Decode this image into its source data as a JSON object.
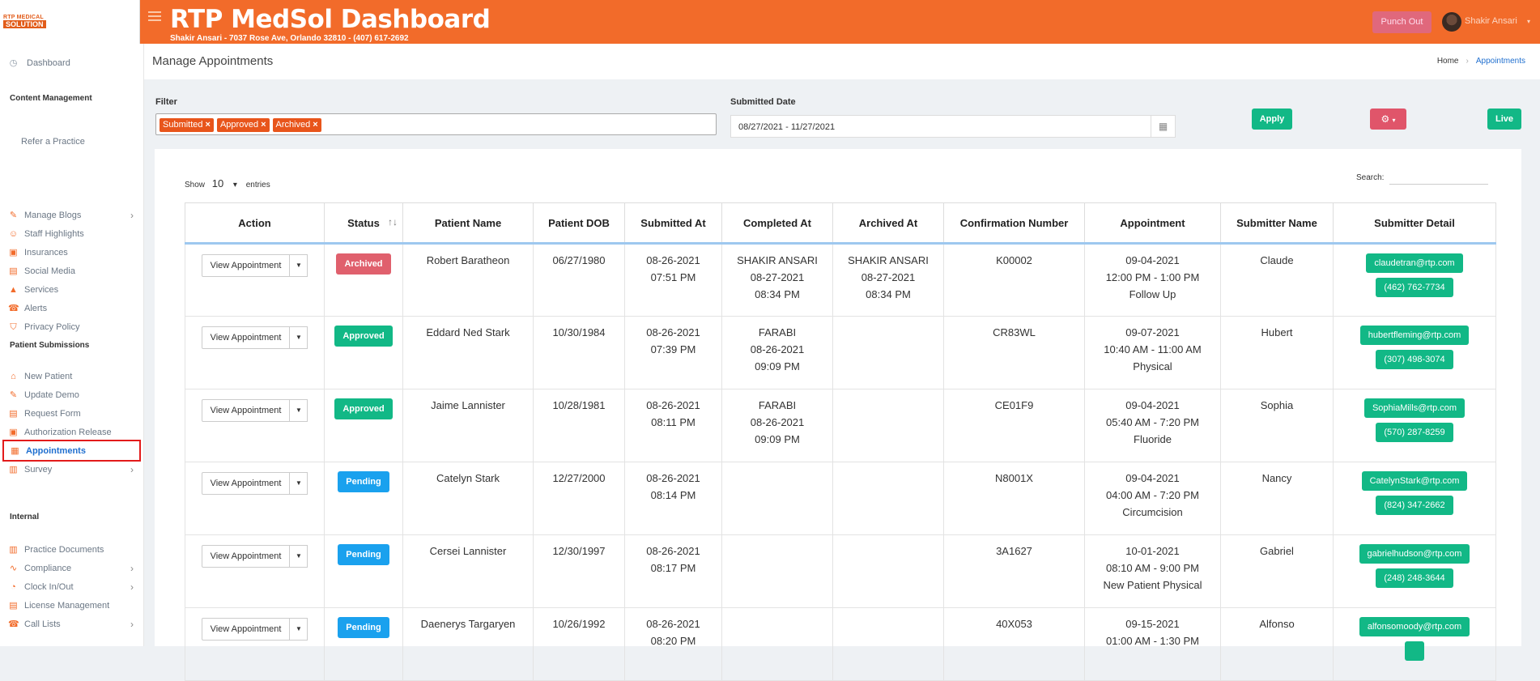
{
  "brand": {
    "logo_line1": "RTP MEDICAL",
    "logo_line2": "SOLUTION"
  },
  "header": {
    "title": "RTP MedSol Dashboard",
    "subtitle": "Shakir Ansari - 7037 Rose Ave, Orlando 32810 - (407) 617-2692",
    "punch_label": "Punch Out",
    "user_name": "Shakir Ansari"
  },
  "sidebar": {
    "dashboard": "Dashboard",
    "content_head": "Content Management",
    "refer": "Refer a Practice",
    "items1": [
      {
        "label": "Manage Blogs",
        "icon": "blog-icon",
        "chevron": true
      },
      {
        "label": "Staff Highlights",
        "icon": "staff-icon"
      },
      {
        "label": "Insurances",
        "icon": "insurance-icon"
      },
      {
        "label": "Social Media",
        "icon": "social-icon"
      },
      {
        "label": "Services",
        "icon": "services-icon"
      },
      {
        "label": "Alerts",
        "icon": "alert-icon"
      },
      {
        "label": "Privacy Policy",
        "icon": "shield-icon"
      }
    ],
    "patient_head": "Patient Submissions",
    "items2": [
      {
        "label": "New Patient",
        "icon": "home-icon"
      },
      {
        "label": "Update Demo",
        "icon": "update-icon"
      },
      {
        "label": "Request Form",
        "icon": "form-icon"
      },
      {
        "label": "Authorization Release",
        "icon": "auth-icon"
      },
      {
        "label": "Appointments",
        "icon": "calendar-icon",
        "active": true
      },
      {
        "label": "Survey",
        "icon": "survey-icon",
        "chevron": true
      }
    ],
    "internal_head": "Internal",
    "items3": [
      {
        "label": "Practice Documents",
        "icon": "documents-icon"
      },
      {
        "label": "Compliance",
        "icon": "compliance-icon",
        "chevron": true
      },
      {
        "label": "Clock In/Out",
        "icon": "clock-icon",
        "chevron": true
      },
      {
        "label": "License Management",
        "icon": "license-icon"
      },
      {
        "label": "Call Lists",
        "icon": "phone-icon",
        "chevron": true
      }
    ]
  },
  "page": {
    "title": "Manage Appointments",
    "breadcrumb_home": "Home",
    "breadcrumb_current": "Appointments"
  },
  "filters": {
    "filter_label": "Filter",
    "tags": [
      "Submitted",
      "Approved",
      "Archived"
    ],
    "date_label": "Submitted Date",
    "date_value": "08/27/2021 - 11/27/2021",
    "apply_label": "Apply",
    "live_label": "Live"
  },
  "table": {
    "show_label": "Show",
    "show_value": "10",
    "entries_label": "entries",
    "search_label": "Search:",
    "columns": [
      "Action",
      "Status",
      "Patient Name",
      "Patient DOB",
      "Submitted At",
      "Completed At",
      "Archived At",
      "Confirmation Number",
      "Appointment",
      "Submitter Name",
      "Submitter Detail"
    ],
    "action_label": "View Appointment",
    "rows": [
      {
        "status": "Archived",
        "status_type": "archived",
        "patient": "Robert Baratheon",
        "dob": "06/27/1980",
        "submitted": [
          "08-26-2021",
          "07:51 PM"
        ],
        "completed": [
          "SHAKIR ANSARI",
          "08-27-2021",
          "08:34 PM"
        ],
        "archived": [
          "SHAKIR ANSARI",
          "08-27-2021",
          "08:34 PM"
        ],
        "confirmation": "K00002",
        "appointment": [
          "09-04-2021",
          "12:00 PM - 1:00 PM",
          "Follow Up"
        ],
        "submitter": "Claude",
        "email": "claudetran@rtp.com",
        "phone": "(462) 762-7734"
      },
      {
        "status": "Approved",
        "status_type": "approved",
        "patient": "Eddard Ned Stark",
        "dob": "10/30/1984",
        "submitted": [
          "08-26-2021",
          "07:39 PM"
        ],
        "completed": [
          "FARABI",
          "08-26-2021",
          "09:09 PM"
        ],
        "archived": [],
        "confirmation": "CR83WL",
        "appointment": [
          "09-07-2021",
          "10:40 AM - 11:00 AM",
          "Physical"
        ],
        "submitter": "Hubert",
        "email": "hubertfleming@rtp.com",
        "phone": "(307) 498-3074"
      },
      {
        "status": "Approved",
        "status_type": "approved",
        "patient": "Jaime Lannister",
        "dob": "10/28/1981",
        "submitted": [
          "08-26-2021",
          "08:11 PM"
        ],
        "completed": [
          "FARABI",
          "08-26-2021",
          "09:09 PM"
        ],
        "archived": [],
        "confirmation": "CE01F9",
        "appointment": [
          "09-04-2021",
          "05:40 AM - 7:20 PM",
          "Fluoride"
        ],
        "submitter": "Sophia",
        "email": "SophiaMills@rtp.com",
        "phone": "(570) 287-8259"
      },
      {
        "status": "Pending",
        "status_type": "pending",
        "patient": "Catelyn Stark",
        "dob": "12/27/2000",
        "submitted": [
          "08-26-2021",
          "08:14 PM"
        ],
        "completed": [],
        "archived": [],
        "confirmation": "N8001X",
        "appointment": [
          "09-04-2021",
          "04:00 AM - 7:20 PM",
          "Circumcision"
        ],
        "submitter": "Nancy",
        "email": "CatelynStark@rtp.com",
        "phone": "(824) 347-2662"
      },
      {
        "status": "Pending",
        "status_type": "pending",
        "patient": "Cersei Lannister",
        "dob": "12/30/1997",
        "submitted": [
          "08-26-2021",
          "08:17 PM"
        ],
        "completed": [],
        "archived": [],
        "confirmation": "3A1627",
        "appointment": [
          "10-01-2021",
          "08:10 AM - 9:00 PM",
          "New Patient Physical"
        ],
        "submitter": "Gabriel",
        "email": "gabrielhudson@rtp.com",
        "phone": "(248) 248-3644"
      },
      {
        "status": "Pending",
        "status_type": "pending",
        "patient": "Daenerys Targaryen",
        "dob": "10/26/1992",
        "submitted": [
          "08-26-2021",
          "08:20 PM"
        ],
        "completed": [],
        "archived": [],
        "confirmation": "40X053",
        "appointment": [
          "09-15-2021",
          "01:00 AM - 1:30 PM",
          ""
        ],
        "submitter": "Alfonso",
        "email": "alfonsomoody@rtp.com",
        "phone": ""
      }
    ]
  }
}
